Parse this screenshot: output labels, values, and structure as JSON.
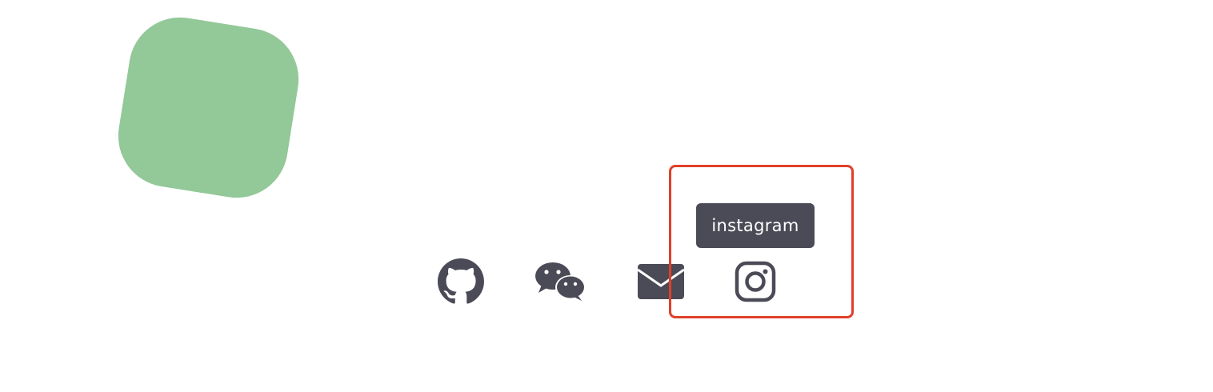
{
  "social_links": {
    "github_icon": "github-icon",
    "wechat_icon": "wechat-icon",
    "email_icon": "mail-icon",
    "instagram_icon": "instagram-icon"
  },
  "tooltip": {
    "label": "instagram"
  },
  "colors": {
    "blob": "#93c898",
    "icon": "#4b4b57",
    "tooltip_bg": "#4b4b57",
    "tooltip_text": "#ffffff",
    "highlight": "#e0402a"
  }
}
